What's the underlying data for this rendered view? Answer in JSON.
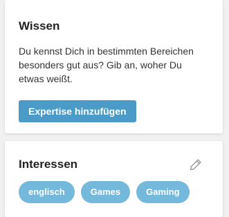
{
  "wissen": {
    "title": "Wissen",
    "text": "Du kennst Dich in bestimmten Bereichen besonders gut aus? Gib an, woher Du etwas weißt.",
    "button_label": "Expertise hinzufügen"
  },
  "interessen": {
    "title": "Interessen",
    "edit_icon": "pencil-icon",
    "tags": [
      {
        "label": "englisch"
      },
      {
        "label": "Games"
      },
      {
        "label": "Gaming"
      }
    ]
  },
  "colors": {
    "background": "#f0f0f0",
    "button": "#4a9bc8",
    "tag": "#74b8dc"
  }
}
